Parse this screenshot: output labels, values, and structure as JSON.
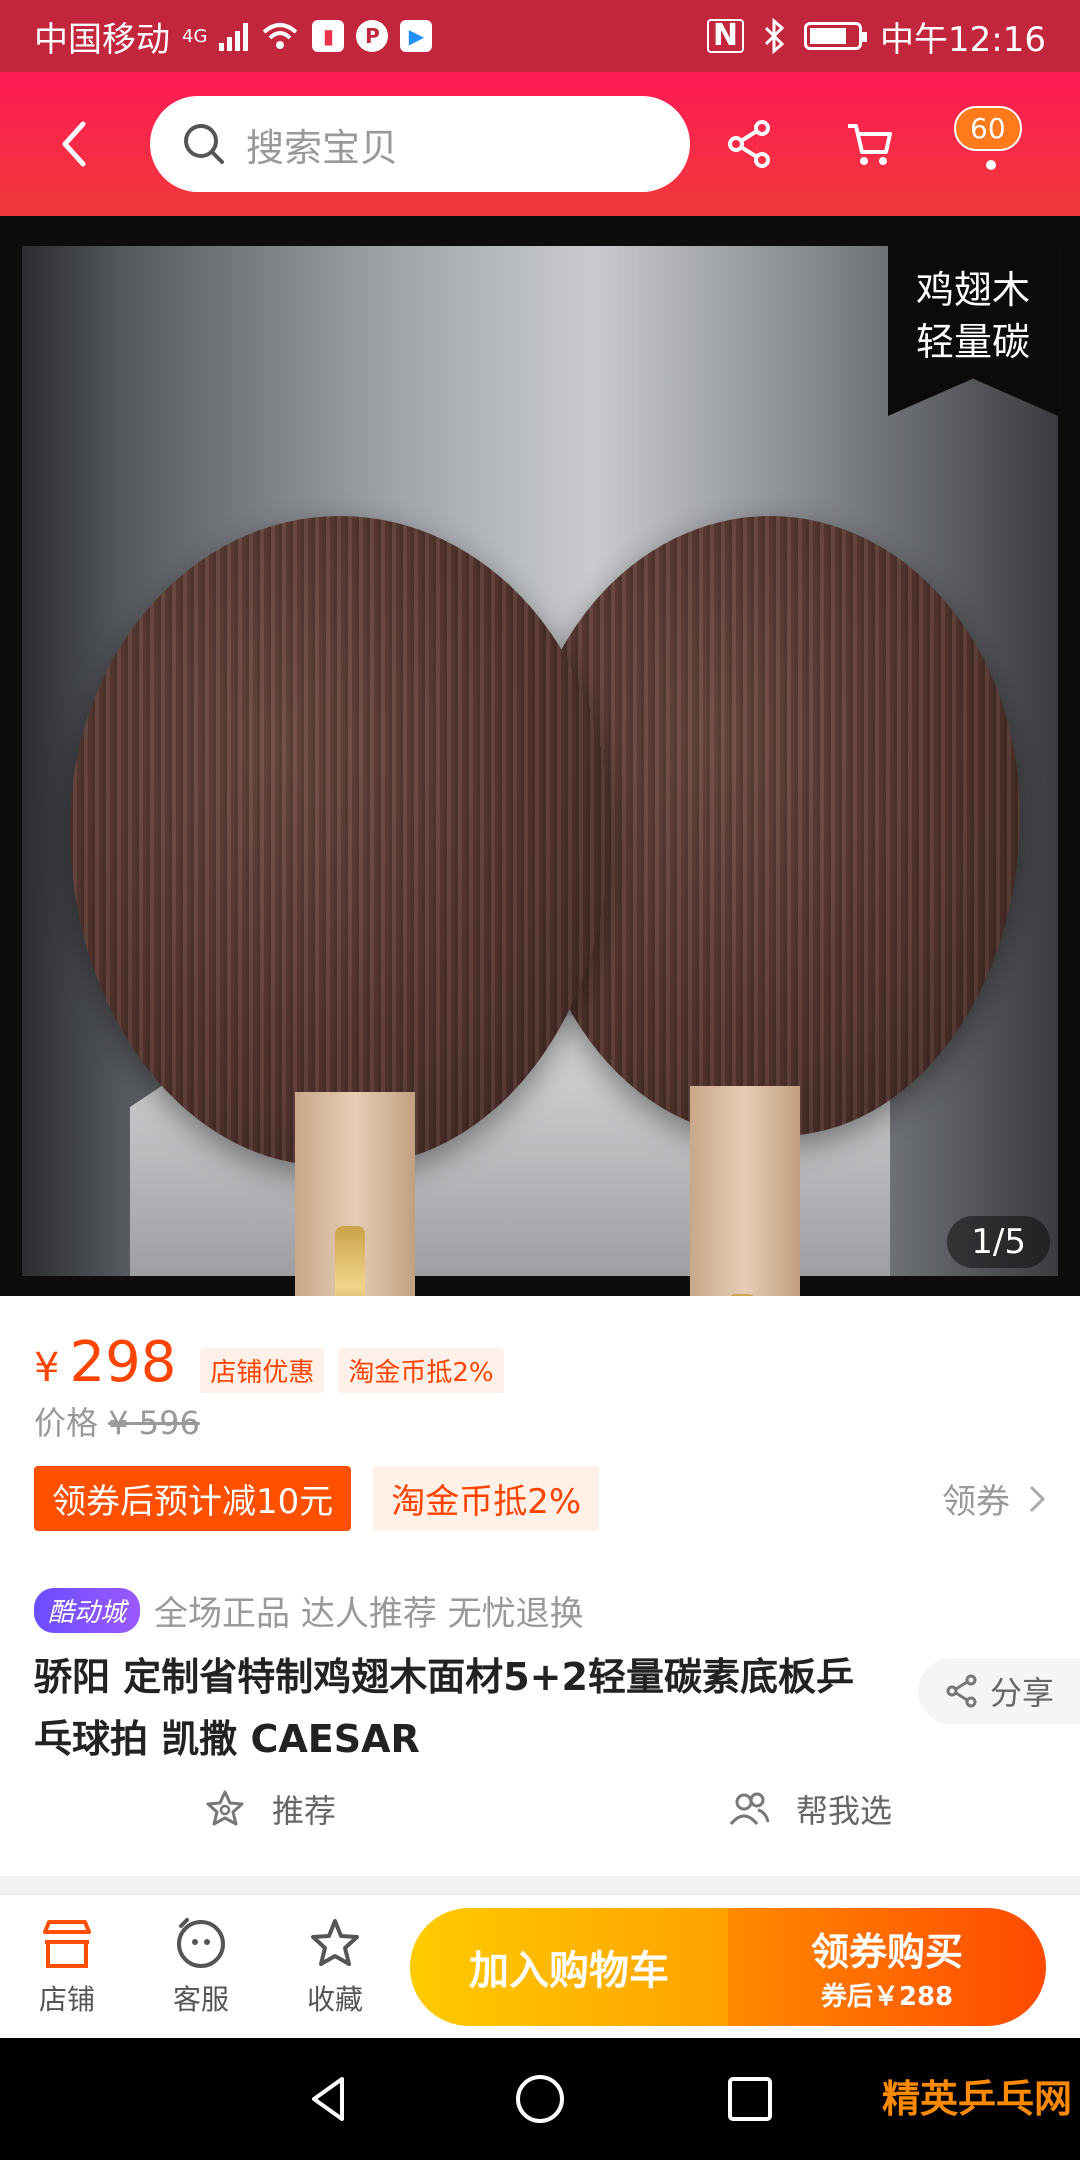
{
  "status_bar": {
    "carrier": "中国移动",
    "network": "4G",
    "time": "中午12:16"
  },
  "header": {
    "search_placeholder": "搜索宝贝",
    "message_count": "60"
  },
  "gallery": {
    "corner_tag_line1": "鸡翅木",
    "corner_tag_line2": "轻量碳",
    "page_indicator": "1/5"
  },
  "price": {
    "currency": "¥",
    "value": "298",
    "tag_shop_discount": "店铺优惠",
    "tag_coin": "淘金币抵2%",
    "original_label": "价格",
    "original_value": "¥ 596"
  },
  "coupon": {
    "main": "领券后预计减10元",
    "sub": "淘金币抵2%",
    "get_label": "领券"
  },
  "badges": {
    "brand_badge": "酷动城",
    "promise": "全场正品 达人推荐 无忧退换"
  },
  "product": {
    "title": "骄阳 定制省特制鸡翅木面材5+2轻量碳素底板乒乓球拍 凯撒 CAESAR",
    "share_label": "分享"
  },
  "actions": {
    "recommend": "推荐",
    "help_choose": "帮我选"
  },
  "bottom_bar": {
    "shop": "店铺",
    "service": "客服",
    "favorite": "收藏",
    "add_cart": "加入购物车",
    "buy_now": "领券购买",
    "buy_now_sub": "券后￥288"
  },
  "watermark": "精英乒乓网",
  "colors": {
    "header_red": "#ff1a55",
    "price_orange": "#ff4400",
    "coupon_orange": "#ff5000",
    "cart_yellow": "#ffcb00",
    "buy_orange": "#ff4a00"
  }
}
